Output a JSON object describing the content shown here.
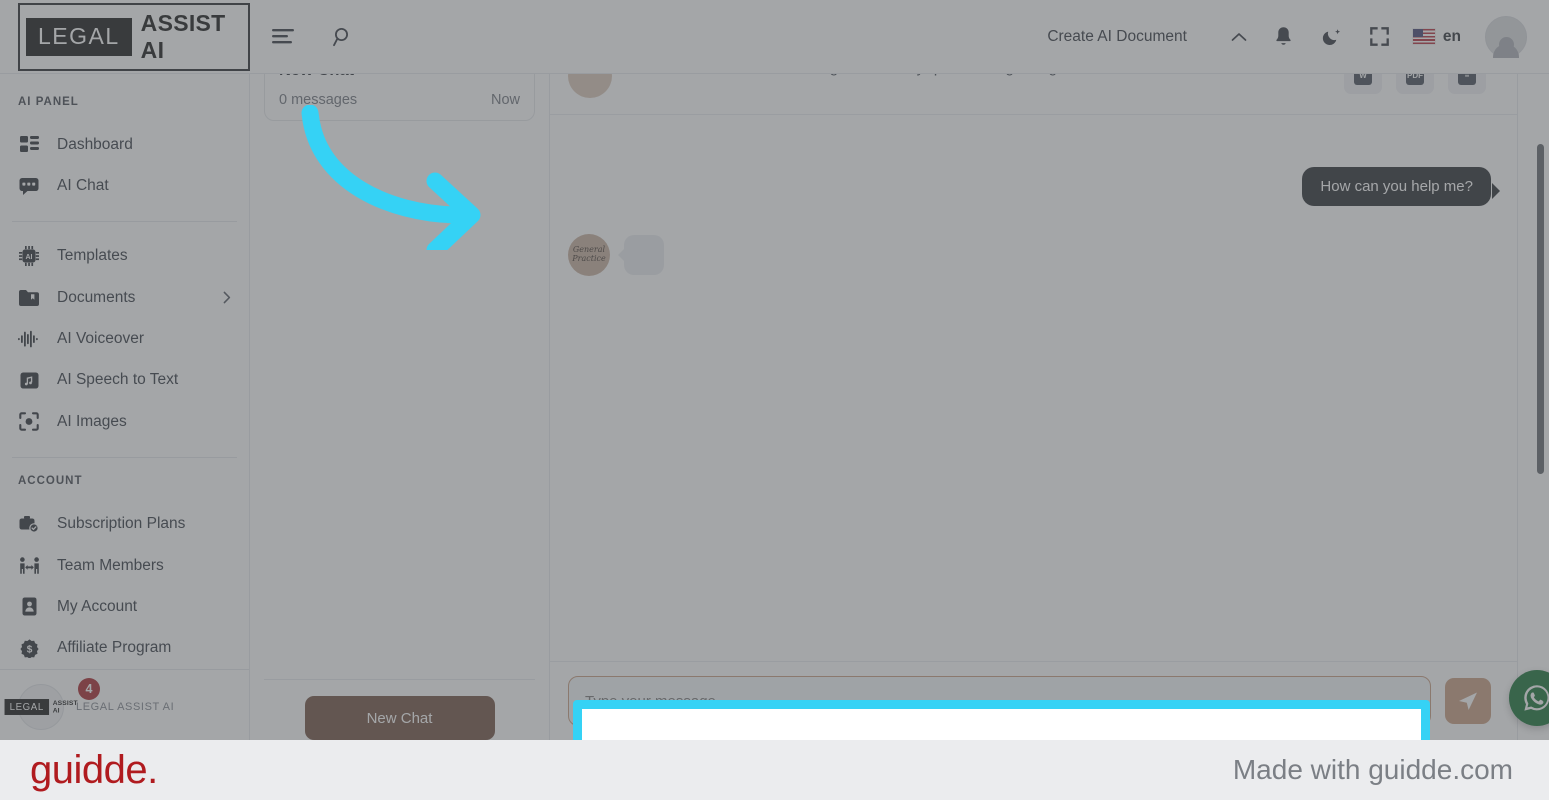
{
  "brand": {
    "legal": "LEGAL",
    "assist": "ASSIST AI"
  },
  "topbar": {
    "menu_icon": "hamburger-icon",
    "search_icon": "search-icon",
    "create_document": "Create AI Document",
    "chevron_icon": "chevron-up-icon",
    "bell_icon": "bell-icon",
    "theme_icon": "moon-icon",
    "fullscreen_icon": "fullscreen-icon",
    "language": "en",
    "flag": "us-flag-icon",
    "avatar": "user-avatar"
  },
  "sidebar": {
    "section_ai": "AI PANEL",
    "section_account": "ACCOUNT",
    "ai_items": [
      {
        "label": "Dashboard",
        "icon": "dashboard-icon"
      },
      {
        "label": "AI Chat",
        "icon": "chat-icon"
      },
      {
        "label": "Templates",
        "icon": "chip-ai-icon"
      },
      {
        "label": "Documents",
        "icon": "folder-icon",
        "caret": "chevron-right-icon"
      },
      {
        "label": "AI Voiceover",
        "icon": "waveform-icon"
      },
      {
        "label": "AI Speech to Text",
        "icon": "folder-music-icon"
      },
      {
        "label": "AI Images",
        "icon": "camera-frame-icon"
      }
    ],
    "account_items": [
      {
        "label": "Subscription Plans",
        "icon": "briefcase-check-icon"
      },
      {
        "label": "Team Members",
        "icon": "team-icon"
      },
      {
        "label": "My Account",
        "icon": "id-card-icon"
      },
      {
        "label": "Affiliate Program",
        "icon": "dollar-badge-icon"
      }
    ],
    "badge_count": "4",
    "profile_caption": "LEGAL ASSIST AI"
  },
  "chatlist": {
    "card_title": "New Chat",
    "card_messages": "0 messages",
    "card_time": "Now",
    "new_chat_button": "New Chat"
  },
  "chat": {
    "header_text": "General Practice - Ask the Legal Assist any question regarding General Practice Law",
    "export_buttons": [
      {
        "label": "W",
        "name": "export-word-button"
      },
      {
        "label": "PDF",
        "name": "export-pdf-button"
      },
      {
        "label": "≡",
        "name": "export-text-button"
      }
    ],
    "user_message": "How can you help me?",
    "bot_avatar_text": "General Practice",
    "composer_placeholder": "Type your message...",
    "composer_value": "",
    "send_icon": "send-icon"
  },
  "fab": {
    "whatsapp": "whatsapp-icon"
  },
  "annotations": {
    "arrow": "cyan-curved-arrow",
    "highlight": "cyan-highlight-box"
  },
  "footer": {
    "logo": "guidde.",
    "made_with": "Made with guidde.com"
  },
  "colors": {
    "accent_cyan": "#35d2f5",
    "brand_red": "#b01b1f",
    "badge_red": "#a51d22",
    "brown": "#6b4a3a",
    "green": "#0d6b2d"
  }
}
